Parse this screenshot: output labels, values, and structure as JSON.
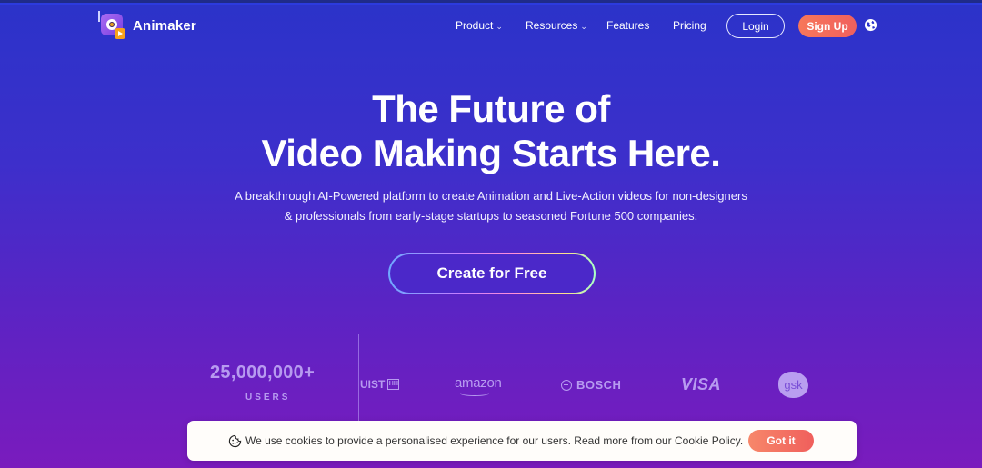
{
  "brand": {
    "name": "Animaker"
  },
  "nav": {
    "items": [
      {
        "label": "Product",
        "has_dropdown": true
      },
      {
        "label": "Resources",
        "has_dropdown": true
      },
      {
        "label": "Features",
        "has_dropdown": false
      },
      {
        "label": "Pricing",
        "has_dropdown": false
      }
    ],
    "chevron": "⌄",
    "login_label": "Login",
    "signup_label": "Sign Up",
    "language_icon": "globe-icon"
  },
  "hero": {
    "title_line1": "The Future of",
    "title_line2": "Video Making Starts Here.",
    "subtitle_line1": "A breakthrough AI-Powered platform to create Animation and Live-Action videos for non-designers",
    "subtitle_line2": "& professionals from early-stage startups to seasoned Fortune 500 companies.",
    "cta_label": "Create for Free"
  },
  "stats": {
    "users_count": "25,000,000+",
    "users_label": "USERS"
  },
  "client_logos": [
    {
      "name": "UIST",
      "badge": "HH"
    },
    {
      "name": "amazon"
    },
    {
      "name": "BOSCH"
    },
    {
      "name": "VISA"
    },
    {
      "name": "gsk"
    }
  ],
  "cookie_banner": {
    "text": "We use cookies to provide a personalised experience for our users. Read more from our Cookie Policy.",
    "accept_label": "Got it"
  },
  "colors": {
    "bg_top": "#2b33c9",
    "bg_bottom": "#7a1bbd",
    "accent_orange": "#f26b5b",
    "logo_muted": "#b79bf0"
  }
}
